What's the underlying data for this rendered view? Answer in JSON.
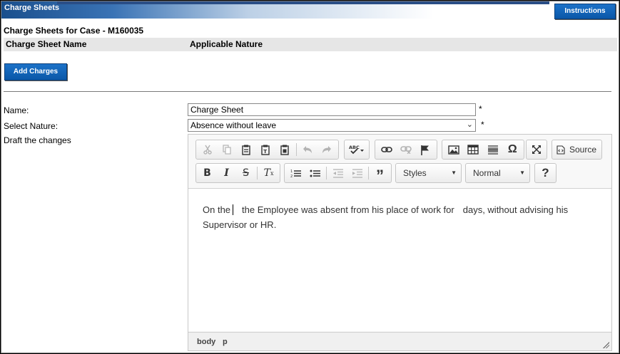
{
  "header": {
    "title": "Charge Sheets",
    "instructions_label": "Instructions"
  },
  "case": {
    "title": "Charge Sheets for Case - M160035"
  },
  "table": {
    "columns": [
      "Charge Sheet Name",
      "Applicable Nature"
    ]
  },
  "actions": {
    "add_charges_label": "Add Charges"
  },
  "form": {
    "name_label": "Name:",
    "name_value": "Charge Sheet",
    "nature_label": "Select Nature:",
    "nature_value": "Absence without leave",
    "draft_label": "Draft the changes",
    "required_mark": "*"
  },
  "editor": {
    "toolbar": {
      "source_label": "Source",
      "styles_label": "Styles",
      "format_label": "Normal",
      "help_label": "?"
    },
    "content": {
      "part1": "On the",
      "part2": "the Employee was absent from his place of work for",
      "part3": "days, without advising his Supervisor or HR."
    },
    "path": [
      "body",
      "p"
    ]
  },
  "colors": {
    "button_blue": "#0a63b8",
    "header_blue": "#1a4f8d"
  }
}
